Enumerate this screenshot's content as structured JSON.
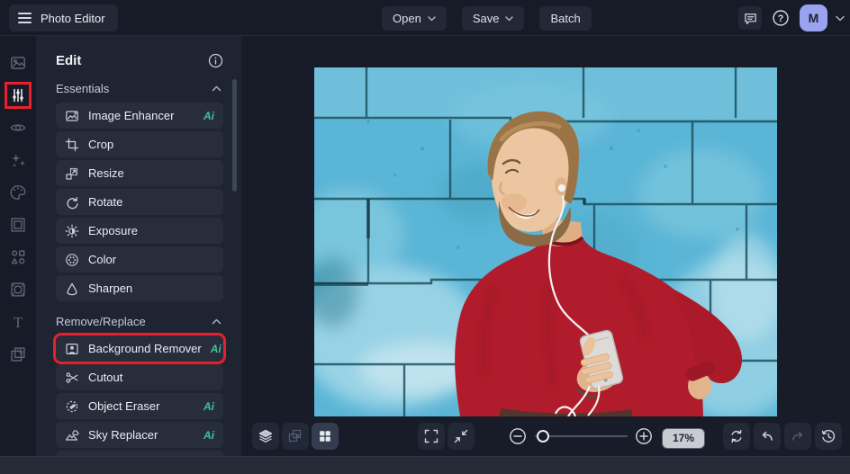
{
  "header": {
    "app_title": "Photo Editor",
    "open_label": "Open",
    "save_label": "Save",
    "batch_label": "Batch",
    "avatar_initial": "M",
    "help_glyph": "?"
  },
  "rail": {
    "items": [
      "image-manager",
      "edit-tools",
      "touch-up",
      "effects",
      "artsy",
      "frames",
      "graphics",
      "overlays",
      "text",
      "textures"
    ],
    "selected": "edit-tools",
    "text_tool_glyph": "T"
  },
  "panel": {
    "title": "Edit",
    "sections": [
      {
        "label": "Essentials",
        "items": [
          {
            "label": "Image Enhancer",
            "badge": "Ai"
          },
          {
            "label": "Crop"
          },
          {
            "label": "Resize"
          },
          {
            "label": "Rotate"
          },
          {
            "label": "Exposure"
          },
          {
            "label": "Color"
          },
          {
            "label": "Sharpen"
          }
        ]
      },
      {
        "label": "Remove/Replace",
        "items": [
          {
            "label": "Background Remover",
            "badge": "Ai",
            "highlighted": true
          },
          {
            "label": "Cutout"
          },
          {
            "label": "Object Eraser",
            "badge": "Ai"
          },
          {
            "label": "Sky Replacer",
            "badge": "Ai"
          }
        ]
      }
    ]
  },
  "toolbar": {
    "zoom_value": "17%"
  },
  "colors": {
    "accent_red": "#e8202c",
    "ai_badge": "#3cc39c",
    "avatar_bg": "#9aa3f0",
    "wall_blue": "#5ab5d6",
    "sweater_red": "#b01c2b"
  }
}
